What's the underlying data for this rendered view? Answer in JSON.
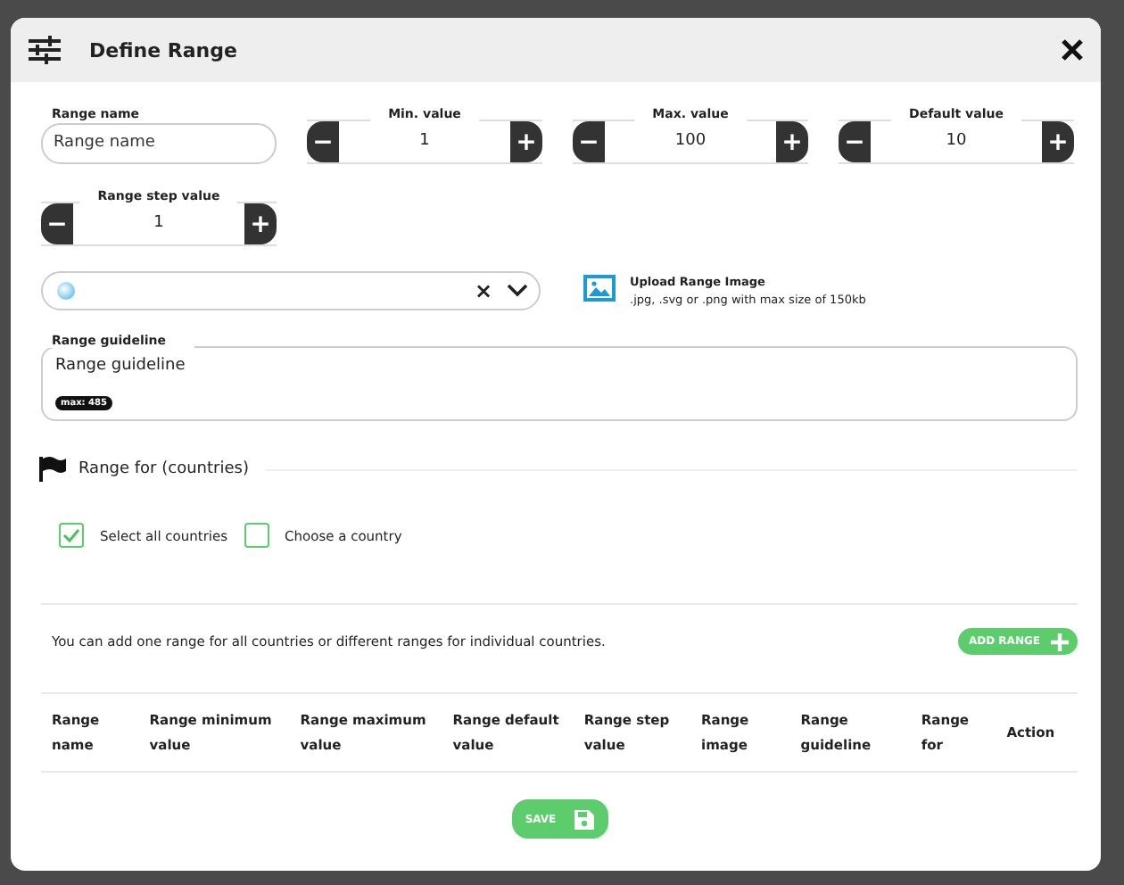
{
  "dialog": {
    "title": "Define Range"
  },
  "name_field": {
    "label": "Range name",
    "placeholder": "Range name"
  },
  "steppers": [
    {
      "label": "Min. value",
      "value": "1",
      "minus": "−",
      "plus": "+"
    },
    {
      "label": "Max. value",
      "value": "100",
      "minus": "−",
      "plus": "+"
    },
    {
      "label": "Default value",
      "value": "10",
      "minus": "−",
      "plus": "+"
    },
    {
      "label": "Range step value",
      "value": "1",
      "minus": "−",
      "plus": "+"
    }
  ],
  "select": {
    "clear": "×"
  },
  "upload": {
    "title": "Upload Range Image",
    "hint": ".jpg, .svg or .png with max size of 150kb"
  },
  "guideline": {
    "label": "Range guideline",
    "placeholder": "Range guideline",
    "counter": "max: 485"
  },
  "countries": {
    "title": "Range for (countries)",
    "options": [
      {
        "label": "Select all countries",
        "checked": true
      },
      {
        "label": "Choose a country",
        "checked": false
      }
    ]
  },
  "info": "You can add one range for all countries or different ranges for individual countries.",
  "add_button": "ADD RANGE",
  "table": {
    "columns": [
      "Range name",
      "Range minimum value",
      "Range maximum value",
      "Range default value",
      "Range step value",
      "Range image",
      "Range guideline",
      "Range for",
      "Action"
    ]
  },
  "save_button": "SAVE"
}
